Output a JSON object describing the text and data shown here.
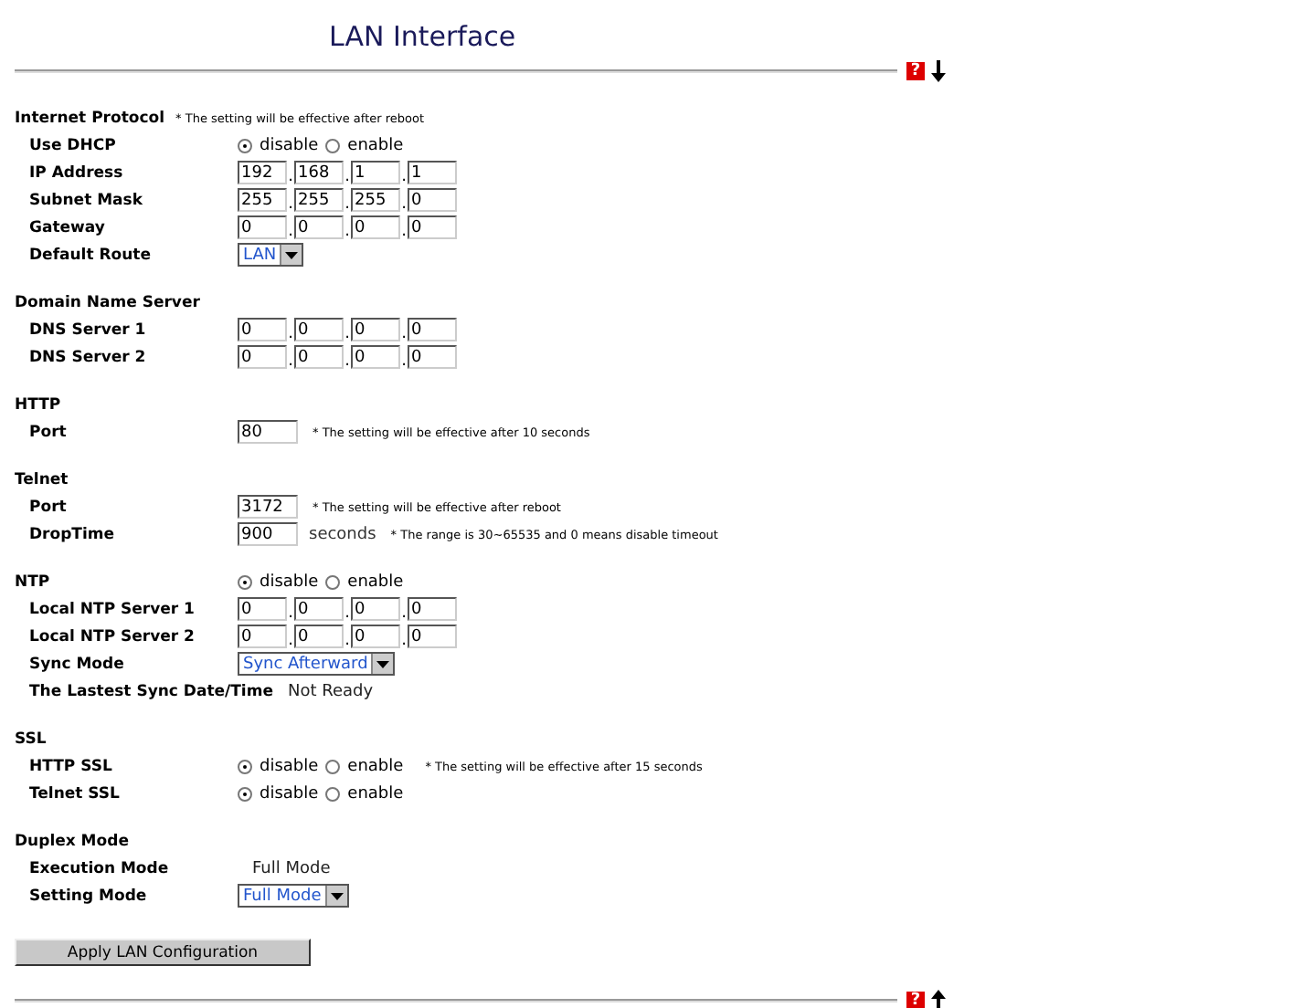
{
  "title": "LAN Interface",
  "help_glyph": "?",
  "octet_separator": ".",
  "sections": [
    {
      "heading": "Internet Protocol",
      "note": "* The setting will be effective after reboot",
      "rows": [
        {
          "kind": "radio",
          "label": "Use DHCP",
          "options": [
            {
              "label": "disable",
              "selected": true
            },
            {
              "label": "enable",
              "selected": false
            }
          ]
        },
        {
          "kind": "ip",
          "label": "IP Address",
          "octets": [
            "192",
            "168",
            "1",
            "1"
          ]
        },
        {
          "kind": "ip",
          "label": "Subnet Mask",
          "octets": [
            "255",
            "255",
            "255",
            "0"
          ]
        },
        {
          "kind": "ip",
          "label": "Gateway",
          "octets": [
            "0",
            "0",
            "0",
            "0"
          ]
        },
        {
          "kind": "select",
          "label": "Default Route",
          "value": "LAN"
        }
      ]
    },
    {
      "heading": "Domain Name Server",
      "rows": [
        {
          "kind": "ip",
          "label": "DNS Server 1",
          "octets": [
            "0",
            "0",
            "0",
            "0"
          ]
        },
        {
          "kind": "ip",
          "label": "DNS Server 2",
          "octets": [
            "0",
            "0",
            "0",
            "0"
          ]
        }
      ]
    },
    {
      "heading": "HTTP",
      "rows": [
        {
          "kind": "input",
          "label": "Port",
          "value": "80",
          "note": "* The setting will be effective after 10 seconds"
        }
      ]
    },
    {
      "heading": "Telnet",
      "rows": [
        {
          "kind": "input",
          "label": "Port",
          "value": "3172",
          "note": "* The setting will be effective after reboot"
        },
        {
          "kind": "input",
          "label": "DropTime",
          "value": "900",
          "unit": "seconds",
          "note": "* The range is 30~65535 and 0 means disable timeout"
        }
      ]
    },
    {
      "heading": "NTP",
      "options": [
        {
          "label": "disable",
          "selected": true
        },
        {
          "label": "enable",
          "selected": false
        }
      ],
      "rows": [
        {
          "kind": "ip",
          "label": "Local NTP Server 1",
          "octets": [
            "0",
            "0",
            "0",
            "0"
          ]
        },
        {
          "kind": "ip",
          "label": "Local NTP Server 2",
          "octets": [
            "0",
            "0",
            "0",
            "0"
          ]
        },
        {
          "kind": "select",
          "label": "Sync Mode",
          "value": "Sync Afterward"
        },
        {
          "kind": "text",
          "label": "The Lastest Sync Date/Time",
          "value": "Not Ready"
        }
      ]
    },
    {
      "heading": "SSL",
      "rows": [
        {
          "kind": "radio",
          "label": "HTTP SSL",
          "options": [
            {
              "label": "disable",
              "selected": true
            },
            {
              "label": "enable",
              "selected": false
            }
          ],
          "note": "* The setting will be effective after 15 seconds"
        },
        {
          "kind": "radio",
          "label": "Telnet SSL",
          "options": [
            {
              "label": "disable",
              "selected": true
            },
            {
              "label": "enable",
              "selected": false
            }
          ]
        }
      ]
    },
    {
      "heading": "Duplex Mode",
      "rows": [
        {
          "kind": "text",
          "label": "Execution Mode",
          "value": "Full Mode"
        },
        {
          "kind": "select",
          "label": "Setting Mode",
          "value": "Full Mode"
        }
      ]
    }
  ],
  "apply_button": "Apply LAN Configuration"
}
